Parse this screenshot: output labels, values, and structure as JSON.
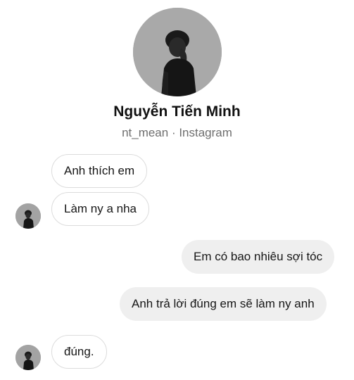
{
  "profile": {
    "name": "Nguyễn Tiến Minh",
    "subtitle": "nt_mean · Instagram",
    "avatar_icon": "profile-photo"
  },
  "messages": [
    {
      "sender": "them",
      "text": "Anh thích em"
    },
    {
      "sender": "them",
      "text": "Làm ny a nha"
    },
    {
      "sender": "me",
      "text": "Em có bao nhiêu sợi tóc"
    },
    {
      "sender": "me",
      "text": "Anh trả lời đúng em sẽ làm ny anh"
    },
    {
      "sender": "them",
      "text": "đúng."
    }
  ],
  "colors": {
    "incoming_bubble_bg": "#ffffff",
    "incoming_bubble_border": "#dcdcdc",
    "outgoing_bubble_bg": "#efefef",
    "subtitle_text": "#6e6e6e"
  }
}
